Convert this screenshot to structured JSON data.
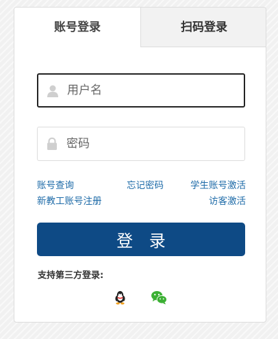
{
  "tabs": [
    {
      "label": "账号登录",
      "active": true
    },
    {
      "label": "扫码登录",
      "active": false
    }
  ],
  "username": {
    "placeholder": "用户名",
    "value": "",
    "icon": "user-icon"
  },
  "password": {
    "placeholder": "密码",
    "value": "",
    "icon": "lock-icon"
  },
  "links": {
    "account_query": "账号查询",
    "forgot_password": "忘记密码",
    "student_activate": "学生账号激活",
    "staff_register": "新教工账号注册",
    "visitor_activate": "访客激活"
  },
  "login_button": "登 录",
  "third_party": {
    "label": "支持第三方登录:",
    "providers": [
      {
        "icon": "qq-icon"
      },
      {
        "icon": "wechat-icon"
      }
    ]
  },
  "colors": {
    "accent": "#0e4a85",
    "link": "#1e6ba8",
    "wechat": "#3cb034"
  }
}
